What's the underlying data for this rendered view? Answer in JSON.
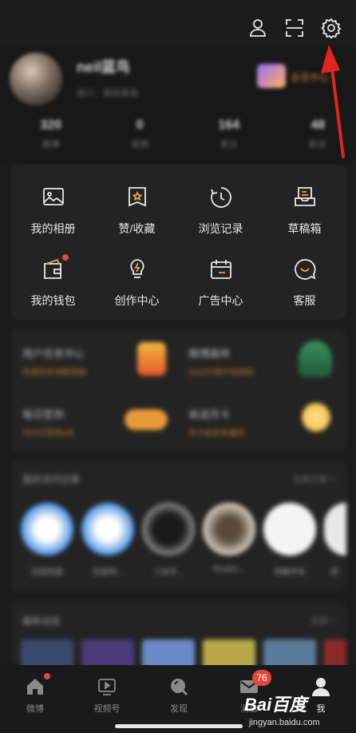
{
  "profile": {
    "username": "neil蓝鸟",
    "bio": "简介：我就是我",
    "vip_text": "会员中心",
    "stats": [
      {
        "num": "320",
        "label": "微博"
      },
      {
        "num": "0",
        "label": "视频"
      },
      {
        "num": "164",
        "label": "关注"
      },
      {
        "num": "48",
        "label": "粉丝"
      }
    ]
  },
  "tools": [
    {
      "label": "我的相册",
      "icon": "photo-album-icon"
    },
    {
      "label": "赞/收藏",
      "icon": "bookmark-star-icon"
    },
    {
      "label": "浏览记录",
      "icon": "history-clock-icon"
    },
    {
      "label": "草稿箱",
      "icon": "drafts-tray-icon"
    },
    {
      "label": "我的钱包",
      "icon": "wallet-icon"
    },
    {
      "label": "创作中心",
      "icon": "lightbulb-icon"
    },
    {
      "label": "广告中心",
      "icon": "calendar-ad-icon"
    },
    {
      "label": "客服",
      "icon": "smile-chat-icon"
    }
  ],
  "services": [
    {
      "title": "用户任务中心",
      "sub": "完成任务领取奖励"
    },
    {
      "title": "微博森林",
      "sub": "2022只用户在种树"
    },
    {
      "title": "每日签到",
      "sub": "今日已签到4天"
    },
    {
      "title": "来送月卡",
      "sub": "月卡会员享福利"
    }
  ],
  "recent": {
    "title": "我的访问记录",
    "more": "全部记录 >",
    "items": [
      "百度网盘",
      "百度网...",
      "小米手...",
      "Rookie...",
      "荣耀手机",
      "荣"
    ]
  },
  "liked": {
    "title": "最新动态",
    "more": "全部 >"
  },
  "tabbar": [
    {
      "label": "微博",
      "icon": "home-icon"
    },
    {
      "label": "视频号",
      "icon": "video-icon"
    },
    {
      "label": "发现",
      "icon": "search-icon"
    },
    {
      "label": "消息",
      "icon": "mail-icon"
    },
    {
      "label": "我",
      "icon": "profile-icon"
    }
  ],
  "message_badge": "76",
  "watermark": {
    "logo": "Bai百度",
    "url": "jingyan.baidu.com"
  },
  "colors": {
    "background": "#1c1c1c",
    "card": "#232323",
    "accent_orange": "#c67a2e",
    "badge_red": "#e0493a",
    "arrow_red": "#e0241e"
  }
}
